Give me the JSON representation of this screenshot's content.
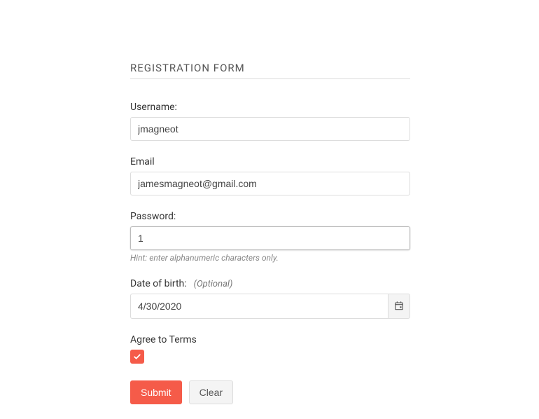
{
  "title": "REGISTRATION FORM",
  "fields": {
    "username": {
      "label": "Username:",
      "value": "jmagneot"
    },
    "email": {
      "label": "Email",
      "value": "jamesmagneot@gmail.com"
    },
    "password": {
      "label": "Password:",
      "value": "1",
      "hint": "Hint: enter alphanumeric characters only."
    },
    "dob": {
      "label": "Date of birth:",
      "optional": "(Optional)",
      "value": "4/30/2020"
    },
    "terms": {
      "label": "Agree to Terms",
      "checked": true
    }
  },
  "buttons": {
    "submit": "Submit",
    "clear": "Clear"
  },
  "colors": {
    "accent": "#f55b49"
  }
}
